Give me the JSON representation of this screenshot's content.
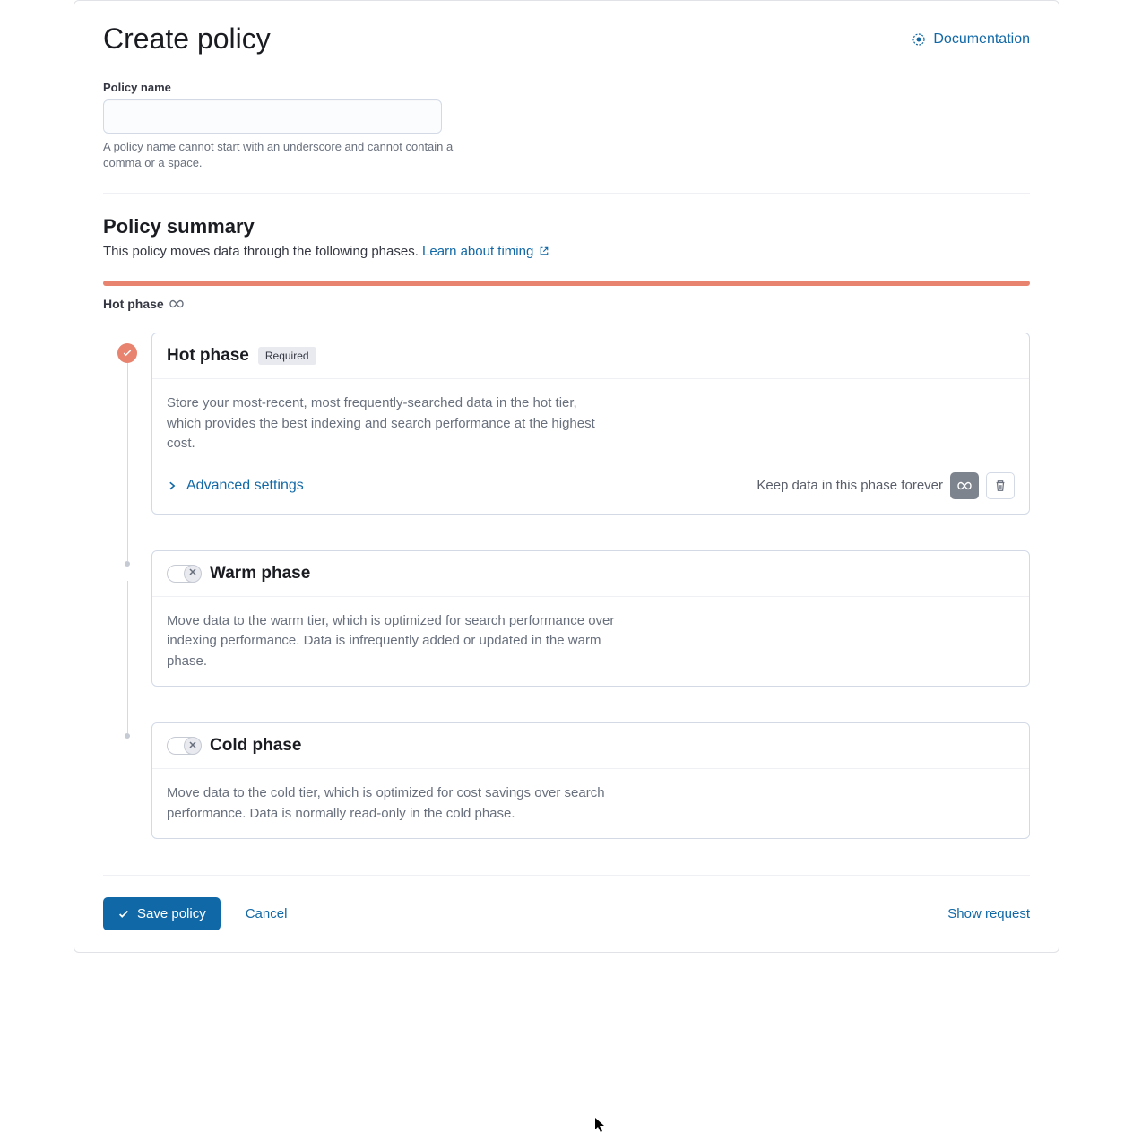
{
  "header": {
    "title": "Create policy",
    "doc_link": "Documentation"
  },
  "policy_name": {
    "label": "Policy name",
    "value": "",
    "help": "A policy name cannot start with an underscore and cannot contain a comma or a space."
  },
  "summary": {
    "title": "Policy summary",
    "desc": "This policy moves data through the following phases.",
    "learn_link": "Learn about timing",
    "hot_label": "Hot phase"
  },
  "colors": {
    "hot_bar": "#e7836f"
  },
  "phases": {
    "hot": {
      "title": "Hot phase",
      "badge": "Required",
      "desc": "Store your most-recent, most frequently-searched data in the hot tier, which provides the best indexing and search performance at the highest cost.",
      "advanced": "Advanced settings",
      "keep_label": "Keep data in this phase forever"
    },
    "warm": {
      "title": "Warm phase",
      "desc": "Move data to the warm tier, which is optimized for search performance over indexing performance. Data is infrequently added or updated in the warm phase."
    },
    "cold": {
      "title": "Cold phase",
      "desc": "Move data to the cold tier, which is optimized for cost savings over search performance. Data is normally read-only in the cold phase."
    }
  },
  "footer": {
    "save": "Save policy",
    "cancel": "Cancel",
    "show_request": "Show request"
  }
}
